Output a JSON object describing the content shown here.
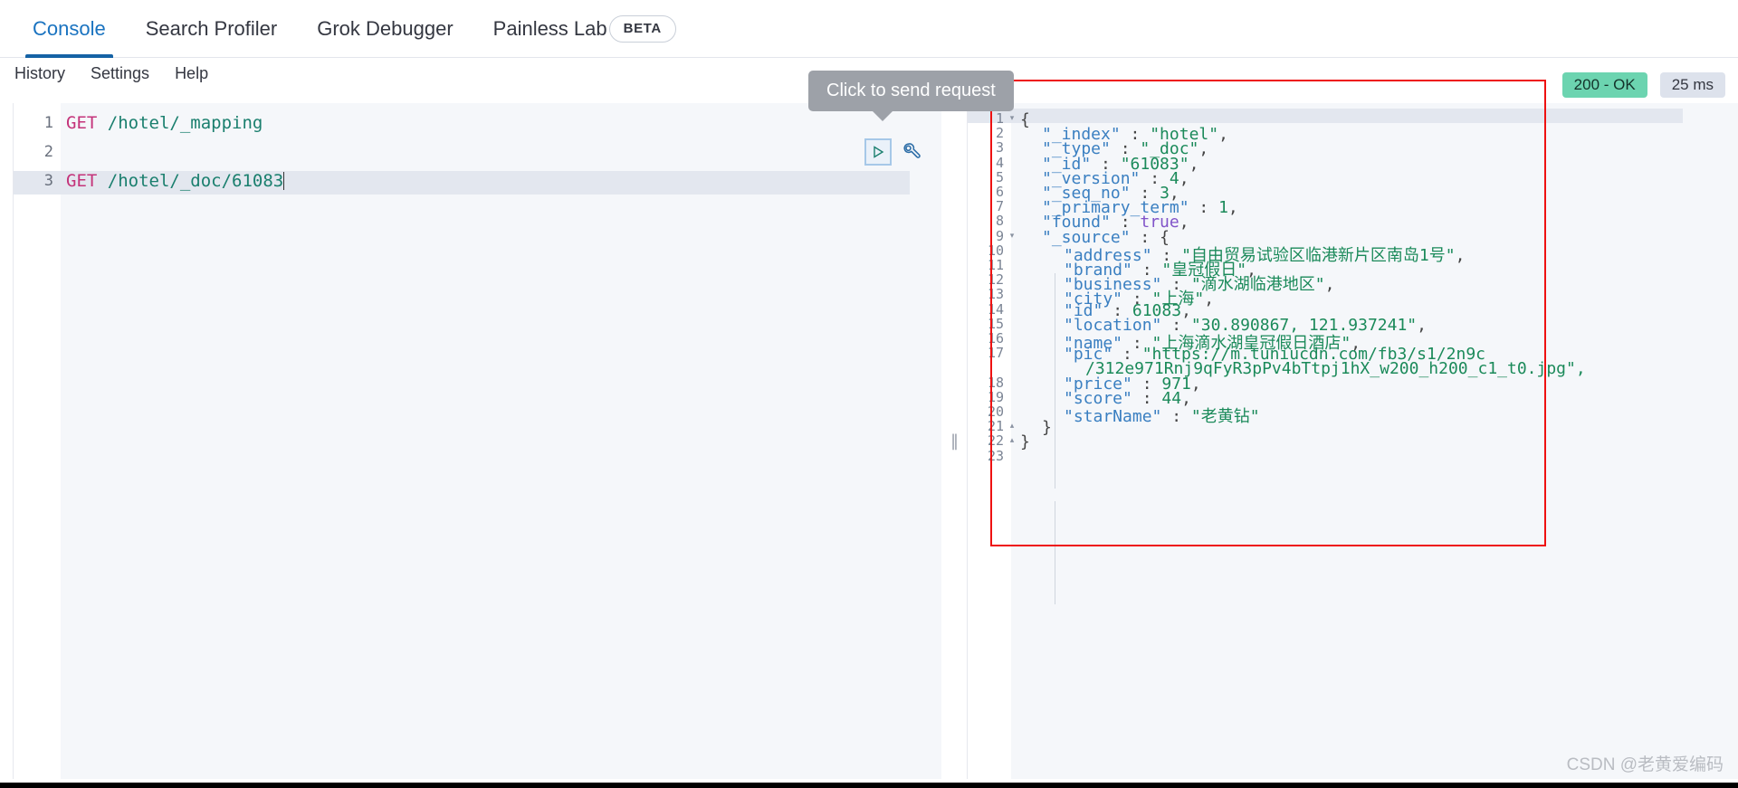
{
  "tabs": [
    {
      "label": "Console",
      "active": true
    },
    {
      "label": "Search Profiler",
      "active": false
    },
    {
      "label": "Grok Debugger",
      "active": false
    },
    {
      "label": "Painless Lab",
      "active": false
    }
  ],
  "beta_badge": "BETA",
  "submenu": [
    {
      "label": "History"
    },
    {
      "label": "Settings"
    },
    {
      "label": "Help"
    }
  ],
  "tooltip": {
    "text": "Click to send request"
  },
  "editor": {
    "lines": [
      {
        "num": "1",
        "method": "GET",
        "url": " /hotel/_mapping",
        "highlighted": false
      },
      {
        "num": "2",
        "method": "",
        "url": "",
        "highlighted": false
      },
      {
        "num": "3",
        "method": "GET",
        "url": " /hotel/_doc/61083",
        "highlighted": true
      }
    ],
    "play_icon": "play-icon",
    "wrench_icon": "wrench-icon"
  },
  "splitter": {
    "grip": "‖"
  },
  "status": {
    "code": "200 - OK",
    "time": "25 ms"
  },
  "response": {
    "lines": [
      {
        "num": "1",
        "fold": "▾",
        "indent": 0,
        "text": "{"
      },
      {
        "num": "2",
        "fold": "",
        "indent": 1,
        "text": "\"_index\" : \"hotel\","
      },
      {
        "num": "3",
        "fold": "",
        "indent": 1,
        "text": "\"_type\" : \"_doc\","
      },
      {
        "num": "4",
        "fold": "",
        "indent": 1,
        "text": "\"_id\" : \"61083\","
      },
      {
        "num": "5",
        "fold": "",
        "indent": 1,
        "text": "\"_version\" : 4,"
      },
      {
        "num": "6",
        "fold": "",
        "indent": 1,
        "text": "\"_seq_no\" : 3,"
      },
      {
        "num": "7",
        "fold": "",
        "indent": 1,
        "text": "\"_primary_term\" : 1,"
      },
      {
        "num": "8",
        "fold": "",
        "indent": 1,
        "text": "\"found\" : true,"
      },
      {
        "num": "9",
        "fold": "▾",
        "indent": 1,
        "text": "\"_source\" : {"
      },
      {
        "num": "10",
        "fold": "",
        "indent": 2,
        "text": "\"address\" : \"自由贸易试验区临港新片区南岛1号\","
      },
      {
        "num": "11",
        "fold": "",
        "indent": 2,
        "text": "\"brand\" : \"皇冠假日\","
      },
      {
        "num": "12",
        "fold": "",
        "indent": 2,
        "text": "\"business\" : \"滴水湖临港地区\","
      },
      {
        "num": "13",
        "fold": "",
        "indent": 2,
        "text": "\"city\" : \"上海\","
      },
      {
        "num": "14",
        "fold": "",
        "indent": 2,
        "text": "\"id\" : 61083,"
      },
      {
        "num": "15",
        "fold": "",
        "indent": 2,
        "text": "\"location\" : \"30.890867, 121.937241\","
      },
      {
        "num": "16",
        "fold": "",
        "indent": 2,
        "text": "\"name\" : \"上海滴水湖皇冠假日酒店\","
      },
      {
        "num": "17",
        "fold": "",
        "indent": 2,
        "text": "\"pic\" : \"https://m.tuniucdn.com/fb3/s1/2n9c"
      },
      {
        "num": "",
        "fold": "",
        "indent": 3,
        "text": "/312e971Rnj9qFyR3pPv4bTtpj1hX_w200_h200_c1_t0.jpg\","
      },
      {
        "num": "18",
        "fold": "",
        "indent": 2,
        "text": "\"price\" : 971,"
      },
      {
        "num": "19",
        "fold": "",
        "indent": 2,
        "text": "\"score\" : 44,"
      },
      {
        "num": "20",
        "fold": "",
        "indent": 2,
        "text": "\"starName\" : \"老黄钻\""
      },
      {
        "num": "21",
        "fold": "▴",
        "indent": 1,
        "text": "}"
      },
      {
        "num": "22",
        "fold": "▴",
        "indent": 0,
        "text": "}"
      },
      {
        "num": "23",
        "fold": "",
        "indent": 0,
        "text": ""
      }
    ]
  },
  "watermark": "CSDN @老黄爱编码",
  "colors": {
    "accent": "#1562a5",
    "ok_badge": "#6cd4b0",
    "annotation": "#ee1111",
    "string": "#1b8a5a",
    "key": "#3a7fc1",
    "bool": "#8154c9"
  }
}
